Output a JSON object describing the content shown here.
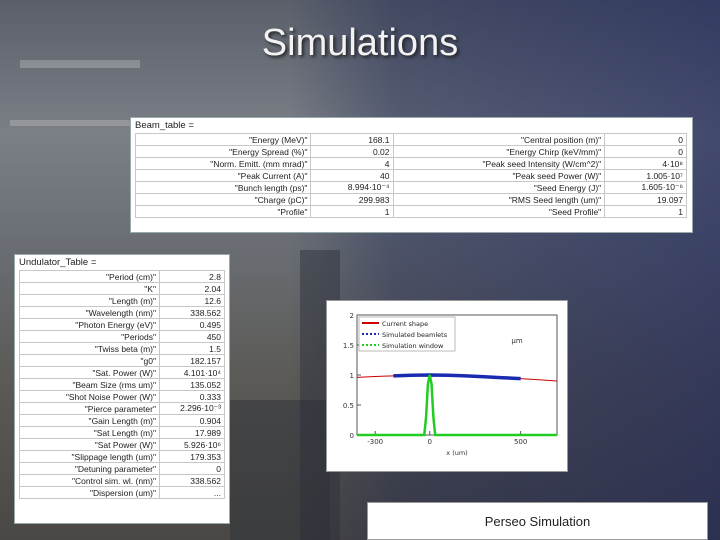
{
  "title": "Simulations",
  "beam_table": {
    "name": "Beam_table",
    "rows": [
      {
        "k1": "\"Energy (MeV)\"",
        "v1": "168.1",
        "k2": "\"Central position (m)\"",
        "v2": "0"
      },
      {
        "k1": "\"Energy Spread (%)\"",
        "v1": "0.02",
        "k2": "\"Energy Chirp (keV/mm)\"",
        "v2": "0"
      },
      {
        "k1": "\"Norm. Emitt. (mm mrad)\"",
        "v1": "4",
        "k2": "\"Peak seed Intensity (W/cm^2)\"",
        "v2": "4·10⁸"
      },
      {
        "k1": "\"Peak Current (A)\"",
        "v1": "40",
        "k2": "\"Peak seed Power (W)\"",
        "v2": "1.005·10⁷"
      },
      {
        "k1": "\"Bunch length (ps)\"",
        "v1": "8.994·10⁻⁴",
        "k2": "\"Seed Energy (J)\"",
        "v2": "1.605·10⁻⁶"
      },
      {
        "k1": "\"Charge (pC)\"",
        "v1": "299.983",
        "k2": "\"RMS Seed length (um)\"",
        "v2": "19.097"
      },
      {
        "k1": "\"Profile\"",
        "v1": "1",
        "k2": "\"Seed Profile\"",
        "v2": "1"
      }
    ]
  },
  "undulator_table": {
    "name": "Undulator_Table",
    "rows": [
      {
        "k": "\"Period (cm)\"",
        "v": "2.8"
      },
      {
        "k": "\"K\"",
        "v": "2.04"
      },
      {
        "k": "\"Length (m)\"",
        "v": "12.6"
      },
      {
        "k": "\"Wavelength (nm)\"",
        "v": "338.562"
      },
      {
        "k": "\"Photon Energy (eV)\"",
        "v": "0.495"
      },
      {
        "k": "\"Periods\"",
        "v": "450"
      },
      {
        "k": "\"Twiss beta (m)\"",
        "v": "1.5"
      },
      {
        "k": "\"g0\"",
        "v": "182.157"
      },
      {
        "k": "\"Sat. Power (W)\"",
        "v": "4.101·10⁴"
      },
      {
        "k": "\"Beam Size (rms um)\"",
        "v": "135.052"
      },
      {
        "k": "\"Shot Noise Power (W)\"",
        "v": "0.333"
      },
      {
        "k": "\"Pierce parameter\"",
        "v": "2.296·10⁻³"
      },
      {
        "k": "\"Gain Length (m)\"",
        "v": "0.904"
      },
      {
        "k": "\"Sat Length (m)\"",
        "v": "17.989"
      },
      {
        "k": "\"Sat Power (W)\"",
        "v": "5.926·10⁶"
      },
      {
        "k": "\"Slippage length (um)\"",
        "v": "179.353"
      },
      {
        "k": "\"Detuning parameter\"",
        "v": "0"
      },
      {
        "k": "\"Control sim. wl. (nm)\"",
        "v": "338.562"
      },
      {
        "k": "\"Dispersion (um)\"",
        "v": "..."
      }
    ]
  },
  "chart_data": {
    "type": "line",
    "xlabel": "x (um)",
    "unit_label": "μm",
    "ylim": [
      0,
      2
    ],
    "xlim": [
      -400,
      700
    ],
    "x_ticks": [
      "-300",
      "0",
      "500"
    ],
    "y_ticks": [
      "0",
      "0.5",
      "1",
      "1.5",
      "2"
    ],
    "legend": [
      "Current shape",
      "Simulated beamlets",
      "Simulation window"
    ],
    "colors": {
      "current": "#cc0000",
      "beamlets": "#1a2bb0",
      "window": "#22cc22"
    },
    "series": [
      {
        "name": "Current shape",
        "x": [
          -400,
          -300,
          -200,
          -100,
          0,
          100,
          200,
          300,
          400,
          500,
          600,
          700
        ],
        "y": [
          0.96,
          0.975,
          0.985,
          0.995,
          1.0,
          0.995,
          0.985,
          0.97,
          0.955,
          0.94,
          0.92,
          0.9
        ]
      },
      {
        "name": "Simulated beamlets",
        "x": [
          -200,
          -100,
          0,
          100,
          200,
          300,
          400,
          500
        ],
        "y": [
          0.985,
          0.995,
          1.0,
          0.995,
          0.985,
          0.97,
          0.955,
          0.94
        ]
      },
      {
        "name": "Simulation window",
        "x": [
          -400,
          -30,
          -20,
          -10,
          0,
          10,
          20,
          30,
          700
        ],
        "y": [
          0,
          0,
          0.3,
          0.85,
          1.0,
          0.85,
          0.3,
          0,
          0
        ]
      }
    ]
  },
  "caption": "Perseo Simulation"
}
